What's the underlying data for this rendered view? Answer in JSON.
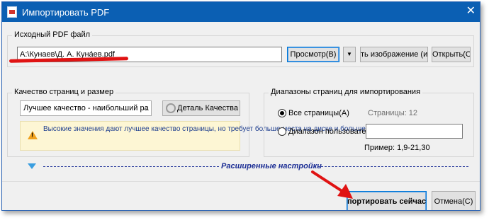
{
  "window": {
    "title": "Импортировать PDF",
    "close_glyph": "✕"
  },
  "source": {
    "group_label": "Исходный PDF файл",
    "file_path": "A:\\Кунаев\\Д. А. Куна́ев.pdf",
    "browse_label": "Просмотр(В)",
    "dropdown_glyph": "▼",
    "image_label": "ть изображение (изо",
    "open_label": "Открыть(О"
  },
  "quality": {
    "group_label": "Качество страниц и размер",
    "selected": "Лучшее качество - наибольший ра",
    "detail_label": "Деталь Качества",
    "warning_text": "Высокие значения дают лучшее качество страницы, но требует больше места на диске и больше времени для скачивания"
  },
  "ranges": {
    "group_label": "Диапазоны страниц для импортирования",
    "all_pages_label": "Все страницы(А)",
    "pages_count": "Страницы: 12",
    "custom_label": "Диапазон пользовател",
    "custom_value": "",
    "example": "Пример: 1,9-21,30"
  },
  "advanced": {
    "label": "Расширенные настройки"
  },
  "footer": {
    "import_label": "портировать сейчас",
    "cancel_label": "Отмена(С)"
  },
  "colors": {
    "title_bar": "#0b5fb3",
    "accent": "#0078d7",
    "annotation": "#e01313"
  }
}
